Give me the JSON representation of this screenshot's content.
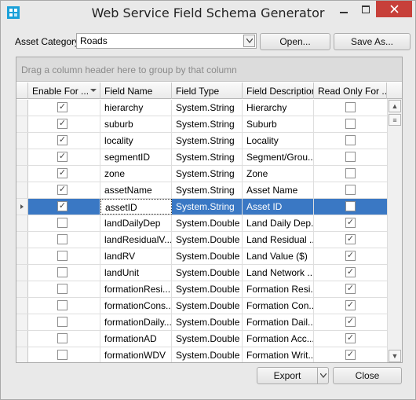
{
  "window": {
    "title": "Web Service Field Schema Generator"
  },
  "toolbar": {
    "asset_category_label": "Asset Category",
    "asset_category_value": "Roads",
    "open_label": "Open...",
    "save_as_label": "Save As..."
  },
  "grid": {
    "group_hint": "Drag a column header here to group by that column",
    "columns": [
      "Enable For ...",
      "Field Name",
      "Field Type",
      "Field Description",
      "Read Only For ..."
    ],
    "rows": [
      {
        "enable": true,
        "name": "hierarchy",
        "type": "System.String",
        "desc": "Hierarchy",
        "readonly": false
      },
      {
        "enable": true,
        "name": "suburb",
        "type": "System.String",
        "desc": "Suburb",
        "readonly": false
      },
      {
        "enable": true,
        "name": "locality",
        "type": "System.String",
        "desc": "Locality",
        "readonly": false
      },
      {
        "enable": true,
        "name": "segmentID",
        "type": "System.String",
        "desc": "Segment/Grou...",
        "readonly": false
      },
      {
        "enable": true,
        "name": "zone",
        "type": "System.String",
        "desc": "Zone",
        "readonly": false
      },
      {
        "enable": true,
        "name": "assetName",
        "type": "System.String",
        "desc": "Asset Name",
        "readonly": false
      },
      {
        "enable": true,
        "name": "assetID",
        "type": "System.String",
        "desc": "Asset ID",
        "readonly": false,
        "selected": true
      },
      {
        "enable": false,
        "name": "landDailyDep",
        "type": "System.Double",
        "desc": "Land Daily Dep...",
        "readonly": true
      },
      {
        "enable": false,
        "name": "landResidualV...",
        "type": "System.Double",
        "desc": "Land Residual ...",
        "readonly": true
      },
      {
        "enable": false,
        "name": "landRV",
        "type": "System.Double",
        "desc": "Land Value ($)",
        "readonly": true
      },
      {
        "enable": false,
        "name": "landUnit",
        "type": "System.Double",
        "desc": "Land Network ...",
        "readonly": true
      },
      {
        "enable": false,
        "name": "formationResi...",
        "type": "System.Double",
        "desc": "Formation Resi...",
        "readonly": true
      },
      {
        "enable": false,
        "name": "formationCons...",
        "type": "System.Double",
        "desc": "Formation Con...",
        "readonly": true
      },
      {
        "enable": false,
        "name": "formationDaily...",
        "type": "System.Double",
        "desc": "Formation Dail...",
        "readonly": true
      },
      {
        "enable": false,
        "name": "formationAD",
        "type": "System.Double",
        "desc": "Formation Acc...",
        "readonly": true
      },
      {
        "enable": false,
        "name": "formationWDV",
        "type": "System.Double",
        "desc": "Formation Writ...",
        "readonly": true
      }
    ]
  },
  "footer": {
    "export_label": "Export",
    "close_label": "Close"
  },
  "colors": {
    "selection": "#3a78c4",
    "close_button": "#c7403a"
  },
  "icons": {
    "app": "grid-app-icon",
    "minimize": "minimize-icon",
    "maximize": "maximize-icon",
    "close": "close-icon"
  }
}
